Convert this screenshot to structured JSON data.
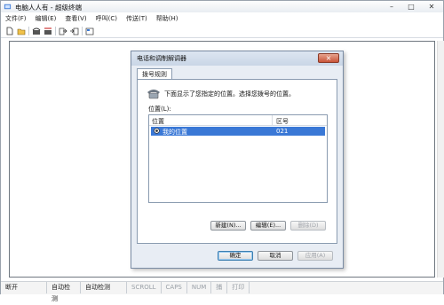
{
  "window": {
    "title": "电脑人人有 - 超级终端"
  },
  "menubar": [
    "文件(F)",
    "编辑(E)",
    "查看(V)",
    "呼叫(C)",
    "传送(T)",
    "帮助(H)"
  ],
  "toolbar": [
    "new-document-icon",
    "open-folder-icon",
    "phone-call-icon",
    "phone-hangup-icon",
    "send-file-icon",
    "receive-file-icon",
    "properties-icon"
  ],
  "statusbar": [
    "断开",
    "自动检测",
    "自动检测",
    "SCROLL",
    "CAPS",
    "NUM",
    "捕",
    "打印"
  ],
  "dialog": {
    "title": "电话和调制解调器",
    "close_label": "×",
    "tab": "拨号规则",
    "info_text": "下面显示了您指定的位置。选择您拨号的位置。",
    "location_label": "位置(L):",
    "list_headers": {
      "name": "位置",
      "code": "区号"
    },
    "rows": [
      {
        "name": "我的位置",
        "code": "021",
        "selected": true
      }
    ],
    "buttons": {
      "new": "新建(N)...",
      "edit": "编辑(E)...",
      "delete": "删除(D)",
      "ok": "确定",
      "cancel": "取消",
      "apply": "应用(A)"
    }
  }
}
